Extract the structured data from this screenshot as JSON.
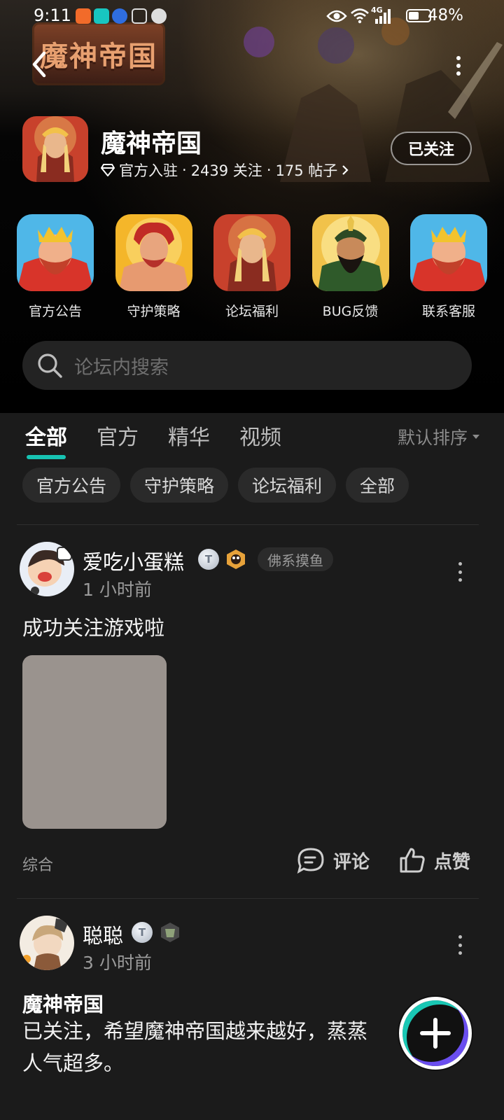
{
  "status_bar": {
    "time": "9:11",
    "battery": "48%",
    "network": "4G"
  },
  "header": {
    "logo_text": "魔神帝国",
    "forum_name": "魔神帝国",
    "verified_label": "官方入驻",
    "followers": "2439 关注",
    "posts": "175 帖子",
    "separator": "·",
    "follow_button": "已关注"
  },
  "shortcuts": [
    {
      "label": "官方公告",
      "icon": "king-avatar-icon"
    },
    {
      "label": "守护策略",
      "icon": "warrior-avatar-icon"
    },
    {
      "label": "论坛福利",
      "icon": "priest-avatar-icon"
    },
    {
      "label": "BUG反馈",
      "icon": "general-avatar-icon"
    },
    {
      "label": "联系客服",
      "icon": "king-avatar-icon"
    }
  ],
  "search": {
    "placeholder": "论坛内搜索"
  },
  "tabs": [
    {
      "label": "全部",
      "active": true
    },
    {
      "label": "官方",
      "active": false
    },
    {
      "label": "精华",
      "active": false
    },
    {
      "label": "视频",
      "active": false
    }
  ],
  "sort": {
    "label": "默认排序"
  },
  "chips": [
    "官方公告",
    "守护策略",
    "论坛福利",
    "全部"
  ],
  "posts": [
    {
      "username": "爱吃小蛋糕",
      "time": "1 小时前",
      "tag": "佛系摸鱼",
      "text": "成功关注游戏啦",
      "category": "综合",
      "comment_label": "评论",
      "like_label": "点赞"
    },
    {
      "username": "聪聪",
      "time": "3 小时前",
      "title": "魔神帝国",
      "text_line1": "已关注，希望魔神帝国越来越好，蒸蒸",
      "text_line2": "人气超多。"
    }
  ],
  "colors": {
    "accent": "#17c3b2",
    "background": "#1b1b1b",
    "chip_bg": "#2a2a2a",
    "muted_text": "#9a9a9a"
  }
}
